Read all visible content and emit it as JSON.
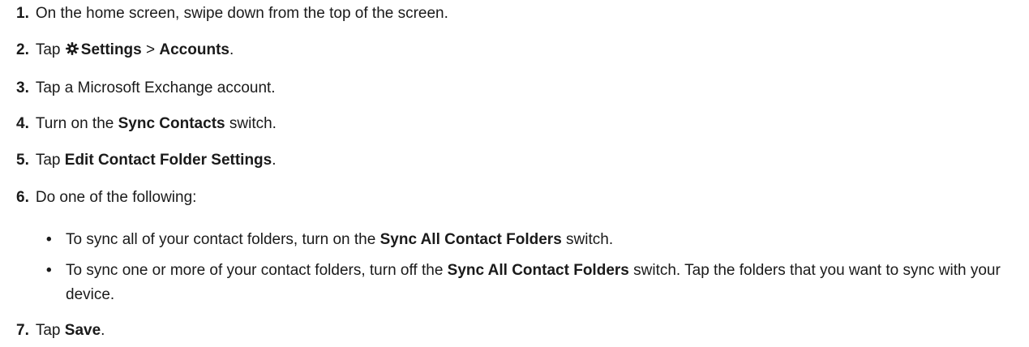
{
  "steps": [
    {
      "num": "1.",
      "text": "On the home screen, swipe down from the top of the screen."
    },
    {
      "num": "2.",
      "pre": "Tap ",
      "b1": "Settings",
      "mid": " > ",
      "b2": "Accounts",
      "post": "."
    },
    {
      "num": "3.",
      "text": "Tap a Microsoft Exchange account."
    },
    {
      "num": "4.",
      "pre": "Turn on the ",
      "b1": "Sync Contacts",
      "post": " switch."
    },
    {
      "num": "5.",
      "pre": "Tap ",
      "b1": "Edit Contact Folder Settings",
      "post": "."
    },
    {
      "num": "6.",
      "text": "Do one of the following:"
    },
    {
      "num": "7.",
      "pre": "Tap ",
      "b1": "Save",
      "post": "."
    }
  ],
  "bullets": [
    {
      "dot": "•",
      "pre": "To sync all of your contact folders, turn on the ",
      "b1": "Sync All Contact Folders",
      "post": " switch."
    },
    {
      "dot": "•",
      "pre": "To sync one or more of your contact folders, turn off the ",
      "b1": "Sync All Contact Folders",
      "post": " switch. Tap the folders that you want to sync with your device."
    }
  ],
  "icons": {
    "settings": "gear-icon"
  }
}
